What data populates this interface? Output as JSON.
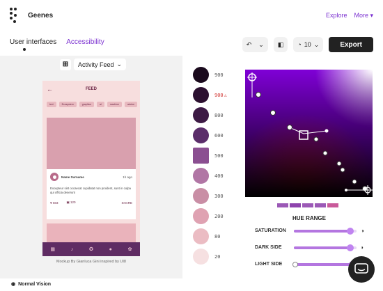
{
  "app": {
    "title": "Geenes"
  },
  "nav": {
    "explore": "Explore",
    "more": "More"
  },
  "tabs": [
    {
      "label": "User interfaces",
      "active": true
    },
    {
      "label": "Accessibility",
      "active": false
    }
  ],
  "toolbar": {
    "count_value": "10",
    "export_label": "Export"
  },
  "mockup": {
    "selector_label": "Activity Feed",
    "header_title": "FEED",
    "chips": [
      "text",
      "Ecosystem",
      "graphics",
      "ai",
      "machine",
      "advice"
    ],
    "card": {
      "name": "Name Surname",
      "time": "1h ago",
      "text": "Excepteur sint occaecat cupidatat non proident, sunt in culpa qui officia deserunt",
      "likes": "603",
      "comments": "120",
      "share": "SHARE"
    },
    "caption": "Mockup By Gianluca Gini inspired by UI8"
  },
  "palette": {
    "swatches": [
      {
        "label": "900",
        "color": "#1a0a1d"
      },
      {
        "label": "900",
        "color": "#2c1030",
        "alert": true,
        "selected": true
      },
      {
        "label": "800",
        "color": "#3d1a45"
      },
      {
        "label": "600",
        "color": "#5b2d6a"
      },
      {
        "label": "500",
        "color": "#8b4f91",
        "square": true
      },
      {
        "label": "400",
        "color": "#b176a5"
      },
      {
        "label": "300",
        "color": "#c98ea5"
      },
      {
        "label": "200",
        "color": "#dfa2b2"
      },
      {
        "label": "80",
        "color": "#ebbcc3"
      },
      {
        "label": "20",
        "color": "#f6e0e1"
      }
    ]
  },
  "picker": {
    "hue_range_label": "HUE RANGE"
  },
  "sliders": [
    {
      "label": "SATURATION",
      "value": 0.9
    },
    {
      "label": "DARK SIDE",
      "value": 0.9
    },
    {
      "label": "LIGHT SIDE",
      "value": 0.93
    }
  ],
  "footer": {
    "vision_label": "Normal Vision"
  }
}
